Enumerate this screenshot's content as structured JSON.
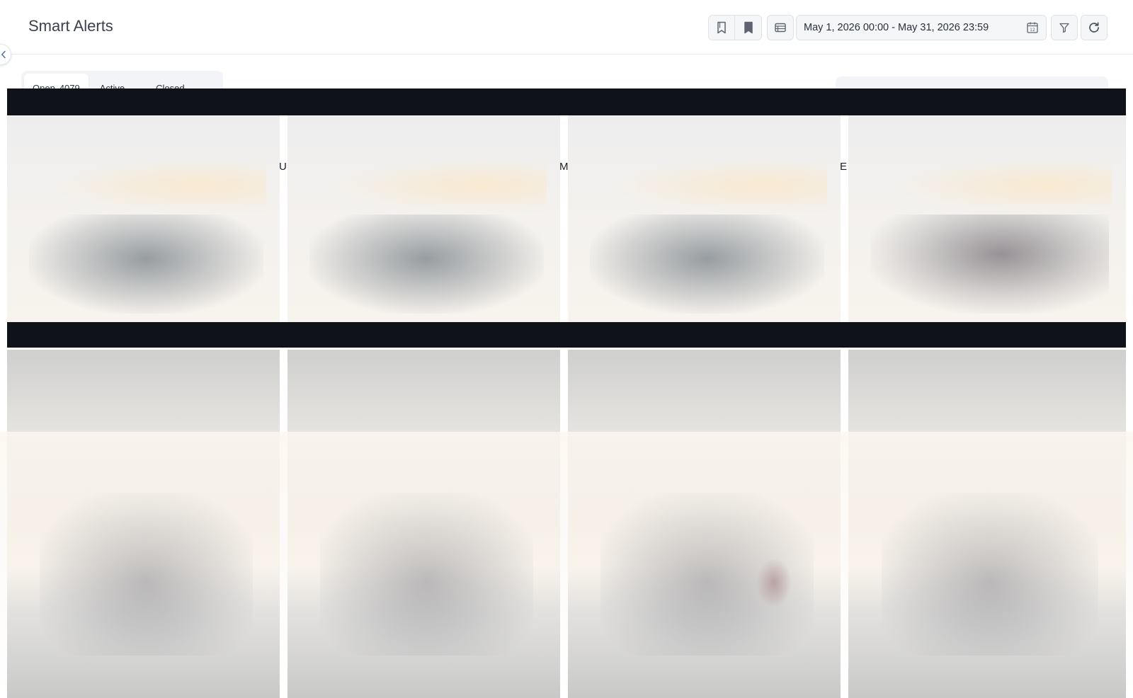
{
  "header": {
    "title": "Smart Alerts",
    "date_range": "May 1, 2026 00:00 - May 31, 2026 23:59"
  },
  "toolbar": {
    "icons": [
      "bookmark-outline-icon",
      "bookmark-filled-icon",
      "table-view-icon",
      "calendar-icon",
      "filter-icon",
      "refresh-icon"
    ]
  },
  "tabs": [
    {
      "label": "Open",
      "count": "4079"
    },
    {
      "label": "Active"
    },
    {
      "label": "Closed"
    }
  ],
  "edge_fragments": [
    "U",
    "M",
    "E"
  ],
  "colors": {
    "bar": "#0f1218",
    "toolbar_bg": "#f4f6f8",
    "accent": "#4a6fa5"
  }
}
